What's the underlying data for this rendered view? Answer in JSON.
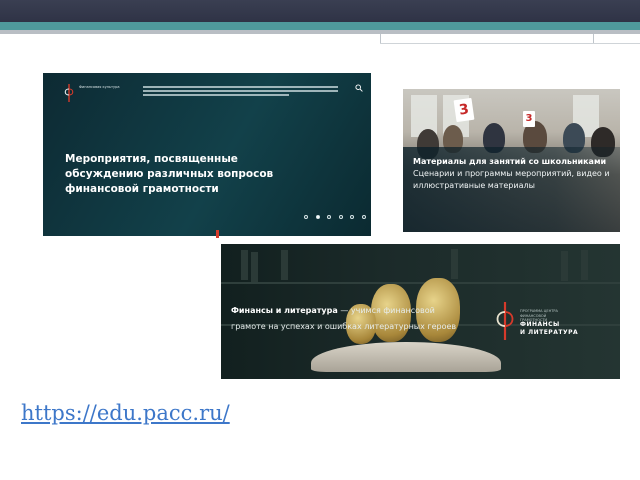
{
  "slide": {
    "link": "https://edu.pacc.ru/"
  },
  "panel1": {
    "logo_text": "Финансовая культура",
    "title": "Мероприятия, посвященные обсуждению различных вопросов финансовой грамотности",
    "carousel_active_index": 1,
    "carousel_count": 6,
    "icons": {
      "search": "search-icon",
      "logo": "logo-icon"
    }
  },
  "panel2": {
    "bold_text": "Материалы для занятий со школьниками",
    "text": " Сценарии и программы мероприятий, видео и иллюстративные материалы",
    "sign_numbers": [
      "3",
      "3"
    ]
  },
  "panel3": {
    "bold_text": "Финансы и литература",
    "text": " — учимся финансовой грамоте на успехах и ошибках литературных героев",
    "logo_small": "ПРОГРАММА ЦЕНТРА ФИНАНСОВОЙ ГРАМОТНОСТИ",
    "logo_line1": "ФИНАНСЫ",
    "logo_line2": "И ЛИТЕРАТУРА"
  },
  "colors": {
    "link": "#3d77c9",
    "topbar": "#2f3346",
    "teal_stripe": "#4f9a9c",
    "accent_red": "#d63a2b"
  }
}
